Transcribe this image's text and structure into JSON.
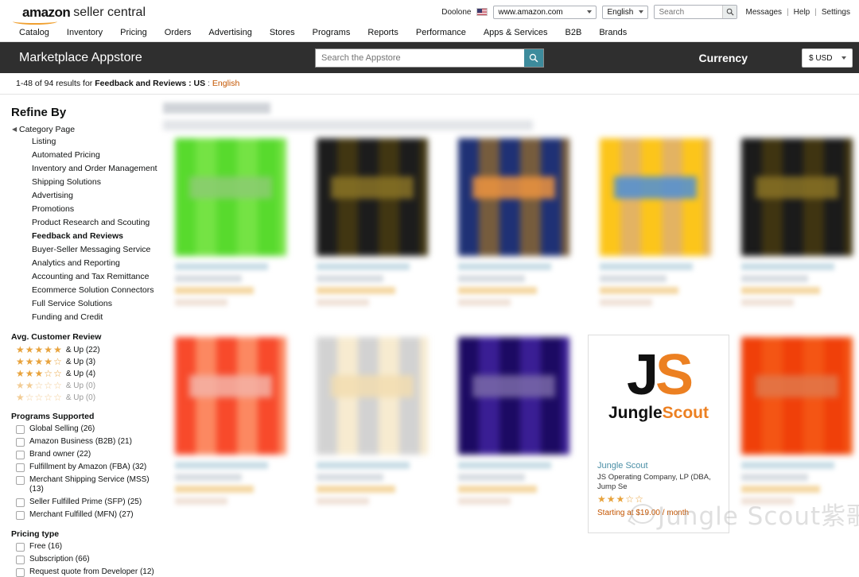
{
  "topbar": {
    "logo_brand": "amazon",
    "logo_suffix": "seller central",
    "account": "Doolone",
    "flag": "us-flag-icon",
    "marketplace": "www.amazon.com",
    "language": "English",
    "search_placeholder": "Search",
    "search_value": "",
    "links": [
      "Messages",
      "Help",
      "Settings"
    ]
  },
  "mainnav": {
    "items": [
      "Catalog",
      "Inventory",
      "Pricing",
      "Orders",
      "Advertising",
      "Stores",
      "Programs",
      "Reports",
      "Performance",
      "Apps & Services",
      "B2B",
      "Brands"
    ]
  },
  "appbar": {
    "title": "Marketplace Appstore",
    "search_placeholder": "Search the Appstore",
    "search_value": "",
    "currency_label": "Currency",
    "currency_value": "$ USD",
    "accent_color": "#3d8b9c",
    "background_color": "#2f2f2f"
  },
  "results": {
    "count_text": "1-48 of 94 results for",
    "filter_text": "Feedback and Reviews : US",
    "separator": ":",
    "language": "English"
  },
  "sidebar": {
    "heading": "Refine By",
    "category_root": "Category Page",
    "categories": [
      {
        "label": "Listing",
        "selected": false
      },
      {
        "label": "Automated Pricing",
        "selected": false
      },
      {
        "label": "Inventory and Order Management",
        "selected": false
      },
      {
        "label": "Shipping Solutions",
        "selected": false
      },
      {
        "label": "Advertising",
        "selected": false
      },
      {
        "label": "Promotions",
        "selected": false
      },
      {
        "label": "Product Research and Scouting",
        "selected": false
      },
      {
        "label": "Feedback and Reviews",
        "selected": true
      },
      {
        "label": "Buyer-Seller Messaging Service",
        "selected": false
      },
      {
        "label": "Analytics and Reporting",
        "selected": false
      },
      {
        "label": "Accounting and Tax Remittance",
        "selected": false
      },
      {
        "label": "Ecommerce Solution Connectors",
        "selected": false
      },
      {
        "label": "Full Service Solutions",
        "selected": false
      },
      {
        "label": "Funding and Credit",
        "selected": false
      }
    ],
    "review_heading": "Avg. Customer Review",
    "reviews": [
      {
        "stars": 5,
        "label": "& Up (22)",
        "zero": false
      },
      {
        "stars": 4,
        "label": "& Up (3)",
        "zero": false
      },
      {
        "stars": 3,
        "label": "& Up (4)",
        "zero": false
      },
      {
        "stars": 2,
        "label": "& Up (0)",
        "zero": true
      },
      {
        "stars": 1,
        "label": "& Up (0)",
        "zero": true
      }
    ],
    "programs_heading": "Programs Supported",
    "programs": [
      {
        "label": "Global Selling (26)",
        "checked": false
      },
      {
        "label": "Amazon Business (B2B) (21)",
        "checked": false
      },
      {
        "label": "Brand owner (22)",
        "checked": false
      },
      {
        "label": "Fulfillment by Amazon (FBA) (32)",
        "checked": false
      },
      {
        "label": "Merchant Shipping Service (MSS) (13)",
        "checked": false
      },
      {
        "label": "Seller Fulfilled Prime (SFP) (25)",
        "checked": false
      },
      {
        "label": "Merchant Fulfilled (MFN) (27)",
        "checked": false
      }
    ],
    "pricing_heading": "Pricing type",
    "pricing": [
      {
        "label": "Free (16)",
        "checked": false
      },
      {
        "label": "Subscription (66)",
        "checked": false
      },
      {
        "label": "Request quote from Developer (12)",
        "checked": false
      }
    ]
  },
  "results_grid": {
    "cards": [
      {
        "id": "card-1",
        "obscured": true,
        "tile_color": "#6aba4c",
        "shade": "#8ccb72"
      },
      {
        "id": "card-2",
        "obscured": true,
        "tile_color": "#3c3c3c",
        "shade": "#8a7326"
      },
      {
        "id": "card-3",
        "obscured": true,
        "tile_color": "#3f4f7a",
        "shade": "#ef9440"
      },
      {
        "id": "card-4",
        "obscured": true,
        "tile_color": "#eba93a",
        "shade": "#4c8ed8"
      },
      {
        "id": "card-5",
        "obscured": true,
        "tile_color": "#3a3a3a",
        "shade": "#8a7326"
      },
      {
        "id": "card-6",
        "obscured": true,
        "tile_color": "#e0614a",
        "shade": "#f3b3a7"
      },
      {
        "id": "card-7",
        "obscured": true,
        "tile_color": "#b3b3b3",
        "shade": "#f2ddb0"
      },
      {
        "id": "card-8",
        "obscured": true,
        "tile_color": "#3c2470",
        "shade": "#7a6aa8"
      },
      {
        "id": "card-9",
        "obscured": false
      },
      {
        "id": "card-10",
        "obscured": true,
        "tile_color": "#d35a22",
        "shade": "#e0784a"
      }
    ],
    "jungle_scout": {
      "mark_j": "J",
      "mark_s": "S",
      "word_1": "Jungle",
      "word_2": "Scout",
      "name": "Jungle Scout",
      "developer": "JS Operating Company, LP (DBA, Jump Se",
      "rating": 3,
      "price": "Starting at $19.00 / month",
      "brand_orange": "#ec8022",
      "link_color": "#4b8fa6",
      "price_color": "#c45500"
    }
  },
  "watermark": {
    "text": "Jungle Scout紫歌",
    "icon": "wechat-icon"
  }
}
